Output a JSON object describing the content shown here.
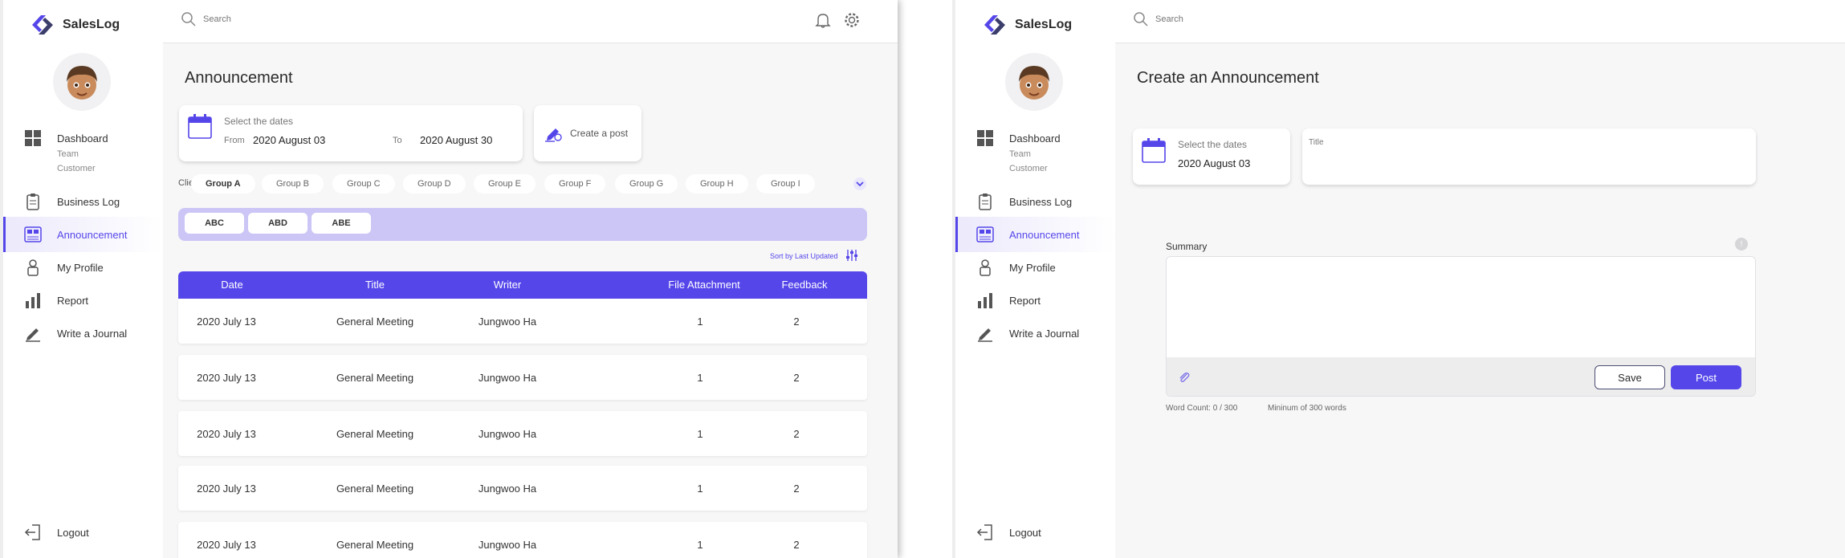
{
  "brand": {
    "name": "SalesLog",
    "accent": "#5546ea",
    "accent_light": "#cbc6f5"
  },
  "nav": {
    "dashboard": "Dashboard",
    "team": "Team",
    "customer": "Customer",
    "business_log": "Business Log",
    "announcement": "Announcement",
    "my_profile": "My Profile",
    "report": "Report",
    "write_journal": "Write a Journal",
    "logout": "Logout"
  },
  "search": {
    "placeholder": "Search"
  },
  "icons": [
    "search-icon",
    "bell-icon",
    "gear-icon",
    "calendar-icon",
    "pen-icon",
    "chevron-down-icon",
    "filter-icon",
    "paperclip-icon",
    "info-icon",
    "logout-icon"
  ],
  "list_screen": {
    "title": "Announcement",
    "dates": {
      "label": "Select the dates",
      "from_label": "From",
      "from": "2020 August 03",
      "to_label": "To",
      "to": "2020 August 30"
    },
    "create_post": "Create a post",
    "client_label": "Client",
    "groups": [
      "Group A",
      "Group B",
      "Group C",
      "Group D",
      "Group E",
      "Group F",
      "Group G",
      "Group H",
      "Group I"
    ],
    "selected_group": "Group A",
    "tags": [
      "ABC",
      "ABD",
      "ABE"
    ],
    "sort_label": "Sort by Last Updated",
    "columns": [
      "Date",
      "Title",
      "Writer",
      "File Attachment",
      "Feedback"
    ],
    "rows": [
      {
        "date": "2020 July 13",
        "title": "General Meeting",
        "writer": "Jungwoo Ha",
        "files": "1",
        "feedback": "2"
      },
      {
        "date": "2020 July 13",
        "title": "General Meeting",
        "writer": "Jungwoo Ha",
        "files": "1",
        "feedback": "2"
      },
      {
        "date": "2020 July 13",
        "title": "General Meeting",
        "writer": "Jungwoo Ha",
        "files": "1",
        "feedback": "2"
      },
      {
        "date": "2020 July 13",
        "title": "General Meeting",
        "writer": "Jungwoo Ha",
        "files": "1",
        "feedback": "2"
      },
      {
        "date": "2020 July 13",
        "title": "General Meeting",
        "writer": "Jungwoo Ha",
        "files": "1",
        "feedback": "2"
      }
    ]
  },
  "create_screen": {
    "title": "Create an Announcement",
    "dates": {
      "label": "Select the dates",
      "value": "2020 August 03"
    },
    "title_field_label": "Title",
    "summary_label": "Summary",
    "save": "Save",
    "post": "Post",
    "word_count": "Word Count: 0 / 300",
    "min_words": "Mininum of 300 words"
  }
}
